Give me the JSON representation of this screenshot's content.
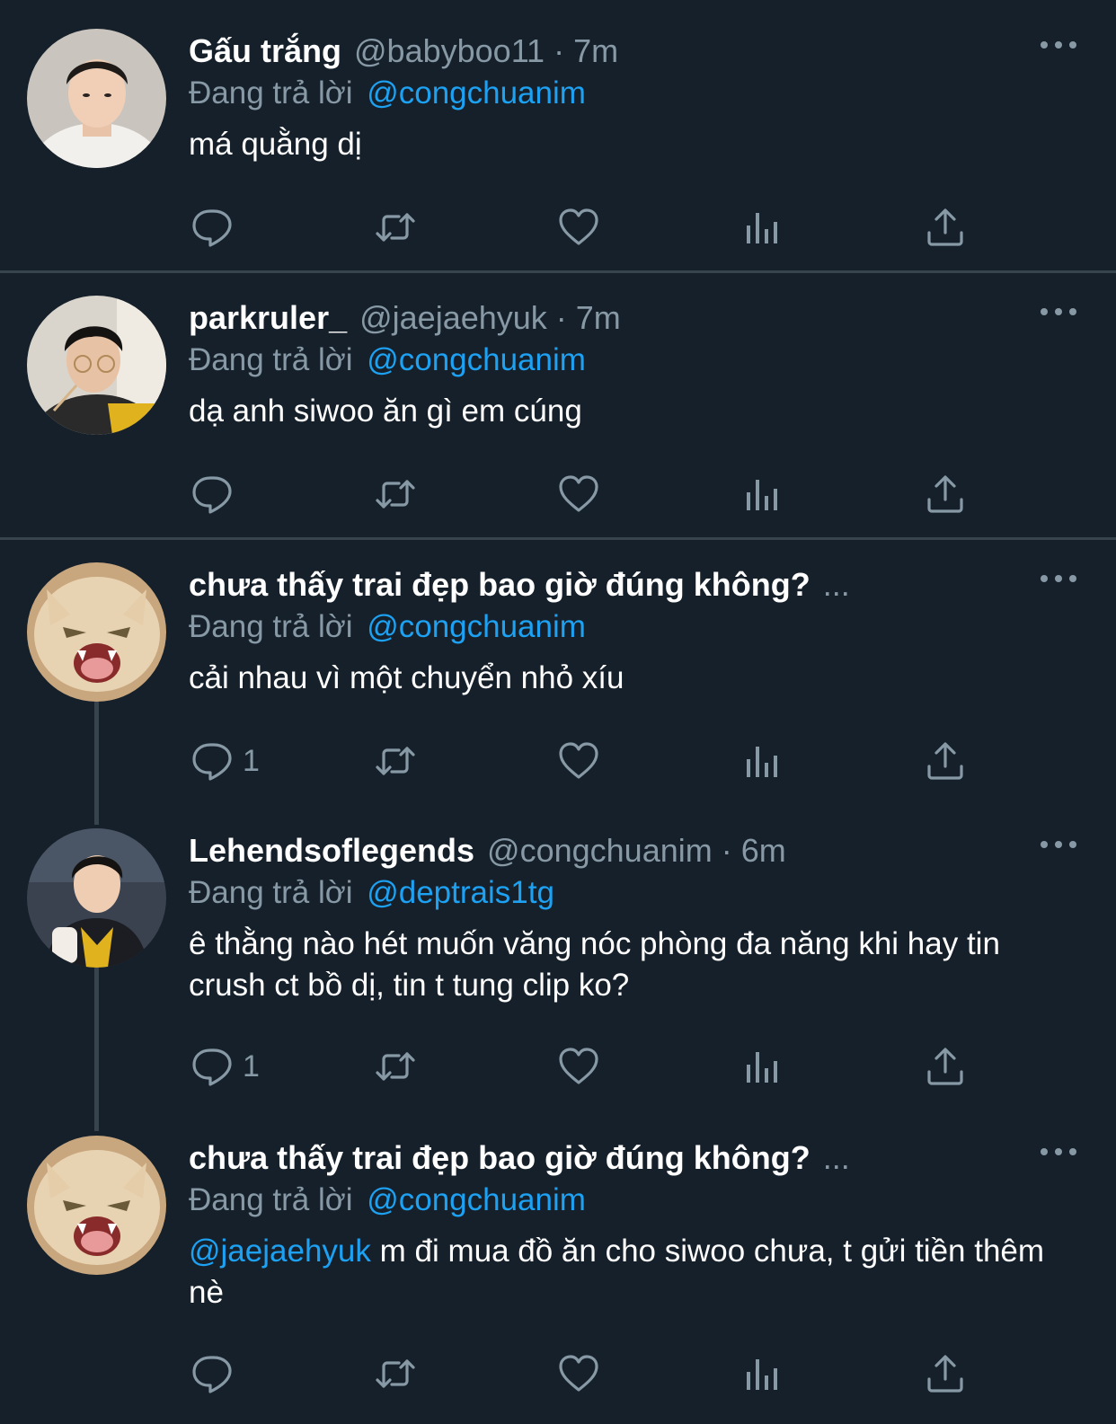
{
  "tweets": [
    {
      "name": "Gấu trắng",
      "handle": "@babyboo11",
      "dot": "·",
      "time": "7m",
      "replying_prefix": "Đang trả lời",
      "replying_to": "@congchuanim",
      "text": "má quằng dị",
      "reply_count": ""
    },
    {
      "name": "parkruler_",
      "handle": "@jaejaehyuk",
      "dot": "·",
      "time": "7m",
      "replying_prefix": "Đang trả lời",
      "replying_to": "@congchuanim",
      "text": "dạ anh siwoo ăn gì em cúng",
      "reply_count": ""
    },
    {
      "name": "chưa thấy trai đẹp bao giờ đúng không?",
      "truncation": "...",
      "replying_prefix": "Đang trả lời",
      "replying_to": "@congchuanim",
      "text": "cải nhau vì một chuyển nhỏ xíu",
      "reply_count": "1"
    },
    {
      "name": "Lehendsoflegends",
      "handle": "@congchuanim",
      "dot": "·",
      "time": "6m",
      "replying_prefix": "Đang trả lời",
      "replying_to": "@deptrais1tg",
      "text": "ê thằng nào hét muốn văng nóc phòng đa năng khi hay tin crush ct bồ dị, tin t tung clip ko?",
      "reply_count": "1"
    },
    {
      "name": "chưa thấy trai đẹp bao giờ đúng không?",
      "truncation": "...",
      "replying_prefix": "Đang trả lời",
      "replying_to": "@congchuanim",
      "text_mention": "@jaejaehyuk",
      "text": "m đi mua đồ ăn cho siwoo chưa, t gửi tiền thêm nè",
      "reply_count": ""
    }
  ],
  "colors": {
    "background": "#15202b",
    "text_primary": "#ffffff",
    "text_secondary": "#8899a6",
    "link": "#1da1f2",
    "divider": "#38444d"
  },
  "icons": [
    "reply-icon",
    "retweet-icon",
    "like-icon",
    "analytics-icon",
    "share-icon",
    "more-icon"
  ]
}
